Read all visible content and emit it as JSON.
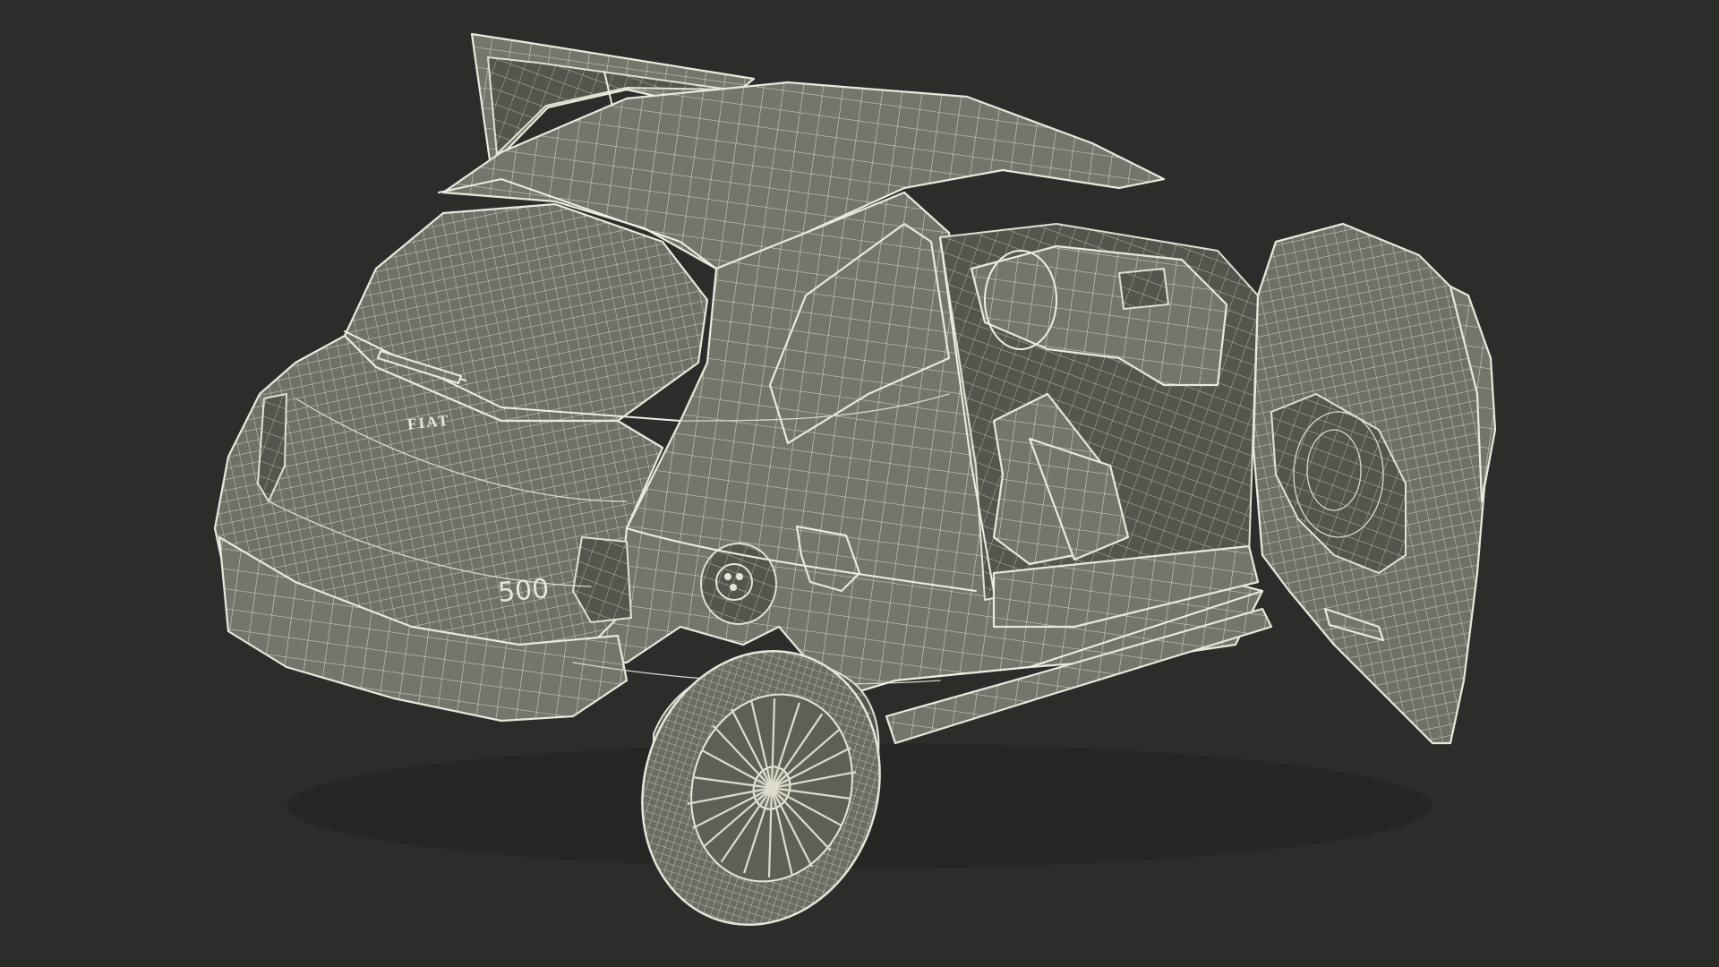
{
  "scene": {
    "background_color": "#2c2c2b",
    "wire_color": "#e9e8dc",
    "surface_color": "#76766c",
    "subject": "fiat-500e-wireframe-model"
  },
  "badges": {
    "brand_logo": "FIAT",
    "model_badge": "500"
  }
}
